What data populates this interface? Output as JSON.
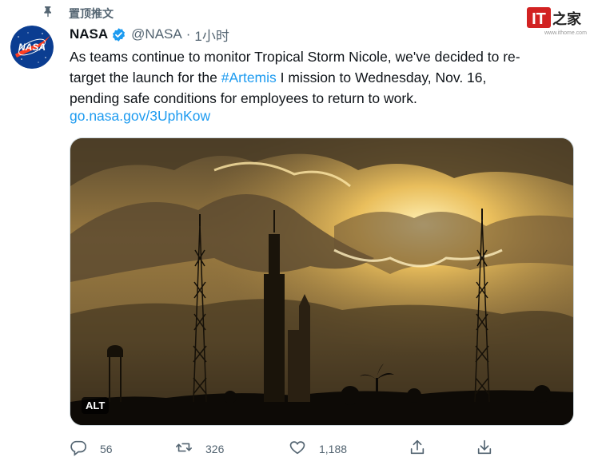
{
  "pinned": {
    "label": "置顶推文",
    "icon": "pin-icon"
  },
  "author": {
    "name": "NASA",
    "handle": "@NASA",
    "separator": "·",
    "time": "1小时",
    "avatar_text": "NASA",
    "verified_icon": "verified-badge-icon"
  },
  "tweet": {
    "text_before": "As teams continue to monitor Tropical Storm Nicole, we've decided to re-\ntarget the launch for the ",
    "hashtag": "#Artemis",
    "text_after": " I mission to Wednesday, Nov. 16,\npending safe conditions for employees to return to work.",
    "link": "go.nasa.gov/3UphKow"
  },
  "media": {
    "alt_badge": "ALT"
  },
  "actions": {
    "replies": "56",
    "retweets": "326",
    "likes": "1,188"
  },
  "watermark": {
    "logo_it": "IT",
    "logo_char": "之家",
    "url": "www.ithome.com"
  },
  "colors": {
    "accent": "#1d9bf0",
    "secondary_text": "#536471",
    "avatar_bg": "#0b3d91",
    "nasa_red": "#fc3d21"
  }
}
